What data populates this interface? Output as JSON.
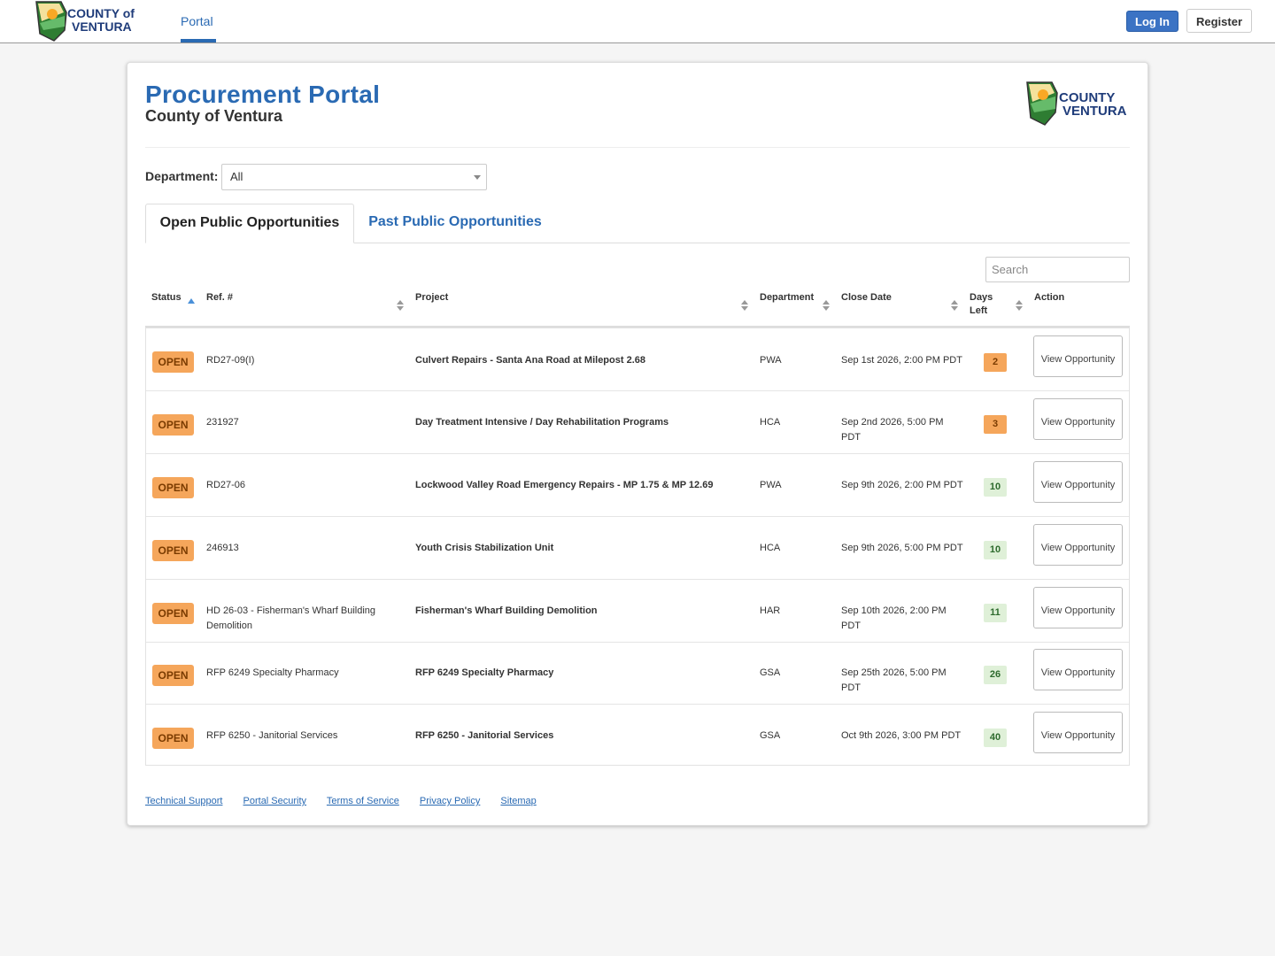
{
  "header": {
    "logo_text": "COUNTY of VENTURA",
    "nav": [
      {
        "label": "Portal"
      }
    ],
    "login_label": "Log In",
    "register_label": "Register"
  },
  "page": {
    "title": "Procurement Portal",
    "subtitle": "County of Ventura",
    "department_label": "Department:",
    "department_value": "All",
    "tabs": [
      {
        "label": "Open Public Opportunities",
        "active": true
      },
      {
        "label": "Past Public Opportunities",
        "active": false
      }
    ],
    "search_placeholder": "Search"
  },
  "table": {
    "columns": [
      "Status",
      "Ref. #",
      "Project",
      "Department",
      "Close Date",
      "Days Left",
      "Action"
    ],
    "rows": [
      {
        "status": "OPEN",
        "ref": "RD27-09(I)",
        "project": "Culvert Repairs - Santa Ana Road at Milepost 2.68",
        "department": "PWA",
        "close_date": "Sep 1st 2026, 2:00 PM PDT",
        "days_left": "2",
        "urgent": true,
        "action": "View Opportunity"
      },
      {
        "status": "OPEN",
        "ref": "231927",
        "project": "Day Treatment Intensive / Day Rehabilitation Programs",
        "department": "HCA",
        "close_date": "Sep 2nd 2026, 5:00 PM PDT",
        "days_left": "3",
        "urgent": true,
        "action": "View Opportunity"
      },
      {
        "status": "OPEN",
        "ref": "RD27-06",
        "project": "Lockwood Valley Road Emergency Repairs - MP 1.75 & MP 12.69",
        "department": "PWA",
        "close_date": "Sep 9th 2026, 2:00 PM PDT",
        "days_left": "10",
        "urgent": false,
        "action": "View Opportunity"
      },
      {
        "status": "OPEN",
        "ref": "246913",
        "project": "Youth Crisis Stabilization Unit",
        "department": "HCA",
        "close_date": "Sep 9th 2026, 5:00 PM PDT",
        "days_left": "10",
        "urgent": false,
        "action": "View Opportunity"
      },
      {
        "status": "OPEN",
        "ref": "HD 26-03 - Fisherman's Wharf Building Demolition",
        "project": "Fisherman's Wharf Building Demolition",
        "department": "HAR",
        "close_date": "Sep 10th 2026, 2:00 PM PDT",
        "days_left": "11",
        "urgent": false,
        "action": "View Opportunity"
      },
      {
        "status": "OPEN",
        "ref": "RFP 6249 Specialty Pharmacy",
        "project": "RFP 6249 Specialty Pharmacy",
        "department": "GSA",
        "close_date": "Sep 25th 2026, 5:00 PM PDT",
        "days_left": "26",
        "urgent": false,
        "action": "View Opportunity"
      },
      {
        "status": "OPEN",
        "ref": "RFP 6250 - Janitorial Services",
        "project": "RFP 6250 - Janitorial Services",
        "department": "GSA",
        "close_date": "Oct 9th 2026, 3:00 PM PDT",
        "days_left": "40",
        "urgent": false,
        "action": "View Opportunity"
      }
    ]
  },
  "footer": {
    "links": [
      "Technical Support",
      "Portal Security",
      "Terms of Service",
      "Privacy Policy",
      "Sitemap"
    ]
  },
  "colors": {
    "brand_blue": "#2a6ab3",
    "login_blue": "#3b73c4",
    "status_orange": "#f5a65b",
    "days_green_bg": "#dff0d8"
  }
}
